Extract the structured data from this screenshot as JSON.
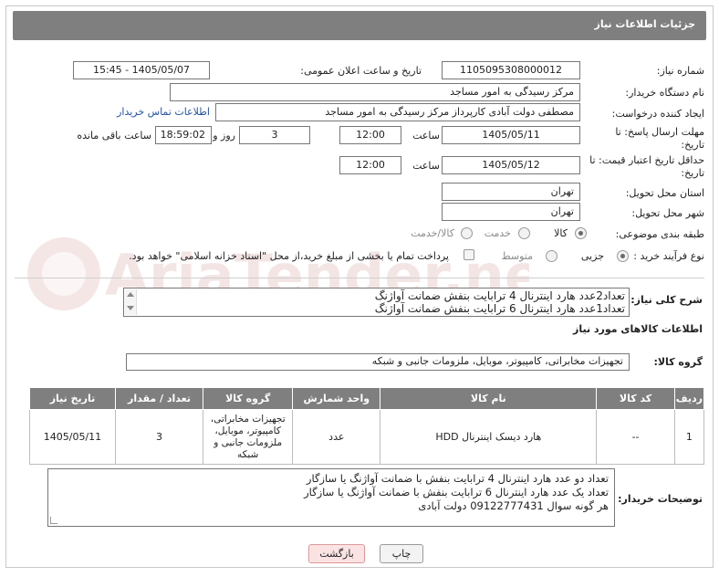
{
  "page_title": "جزئیات اطلاعات نیاز",
  "fields": {
    "need_number_label": "شماره نیاز:",
    "need_number": "1105095308000012",
    "announce_label": "تاریخ و ساعت اعلان عمومی:",
    "announce_value": "1405/05/07 - 15:45",
    "buyer_org_label": "نام دستگاه خریدار:",
    "buyer_org": "مرکز رسیدگی به امور مساجد",
    "creator_label": "ایجاد کننده درخواست:",
    "creator": "مصطفی دولت آبادی کارپرداز مرکز رسیدگی به امور مساجد",
    "contact_link": "اطلاعات تماس خریدار",
    "reply_deadline_label": "مهلت ارسال پاسخ: تا تاریخ:",
    "reply_date": "1405/05/11",
    "time_word": "ساعت",
    "reply_time": "12:00",
    "days_count": "3",
    "days_word": "روز و",
    "remaining_time": "18:59:02",
    "remaining_word": "ساعت باقی مانده",
    "price_validity_label": "حداقل تاریخ اعتبار قیمت: تا تاریخ:",
    "price_date": "1405/05/12",
    "price_time": "12:00",
    "province_label": "استان محل تحویل:",
    "province": "تهران",
    "city_label": "شهر محل تحویل:",
    "city": "تهران",
    "category_label": "طبقه بندی موضوعی:",
    "category_options": [
      "کالا",
      "خدمت",
      "کالا/خدمت"
    ],
    "process_label": "نوع فرآیند خرید :",
    "process_options": [
      "جزیی",
      "متوسط"
    ],
    "payment_note": "پرداخت تمام یا بخشی از مبلغ خرید،از محل \"اسناد خزانه اسلامی\" خواهد بود."
  },
  "description": {
    "label": "شرح کلی نیاز:",
    "lines": [
      "تعداد2عدد هارد اینترنال 4 ترابایت بنفش ضمانت آواژنگ",
      "تعداد1عدد هارد اینترنال 6 ترابایت بنفش ضمانت آواژنگ"
    ]
  },
  "goods_section_title": "اطلاعات کالاهای مورد نیاز",
  "goods_group_label": "گروه کالا:",
  "goods_group": "تجهیزات مخابراتی، کامپیوتر، موبایل، ملزومات جانبی و شبکه",
  "table": {
    "headers": [
      "ردیف",
      "کد کالا",
      "نام کالا",
      "واحد شمارش",
      "گروه کالا",
      "تعداد / مقدار",
      "تاریخ نیاز"
    ],
    "rows": [
      {
        "row": "1",
        "code": "--",
        "name": "هارد دیسک اینترنال HDD",
        "unit": "عدد",
        "group": "تجهیزات مخابراتی، کامپیوتر، موبایل، ملزومات جانبی و شبکه",
        "qty": "3",
        "date": "1405/05/11"
      }
    ]
  },
  "buyer_notes": {
    "label": "توضیحات خریدار:",
    "lines": [
      "تعداد دو عدد هارد اینترنال 4 ترابایت بنفش با ضمانت آواژنگ یا سازگار",
      "تعداد یک عدد هارد اینترنال 6 ترابایت بنفش با ضمانت آواژنگ یا سازگار",
      "هر گونه سوال 09122777431 دولت آبادی"
    ]
  },
  "buttons": {
    "print": "چاپ",
    "back": "بازگشت"
  },
  "watermark_text": "AriaTender.net"
}
